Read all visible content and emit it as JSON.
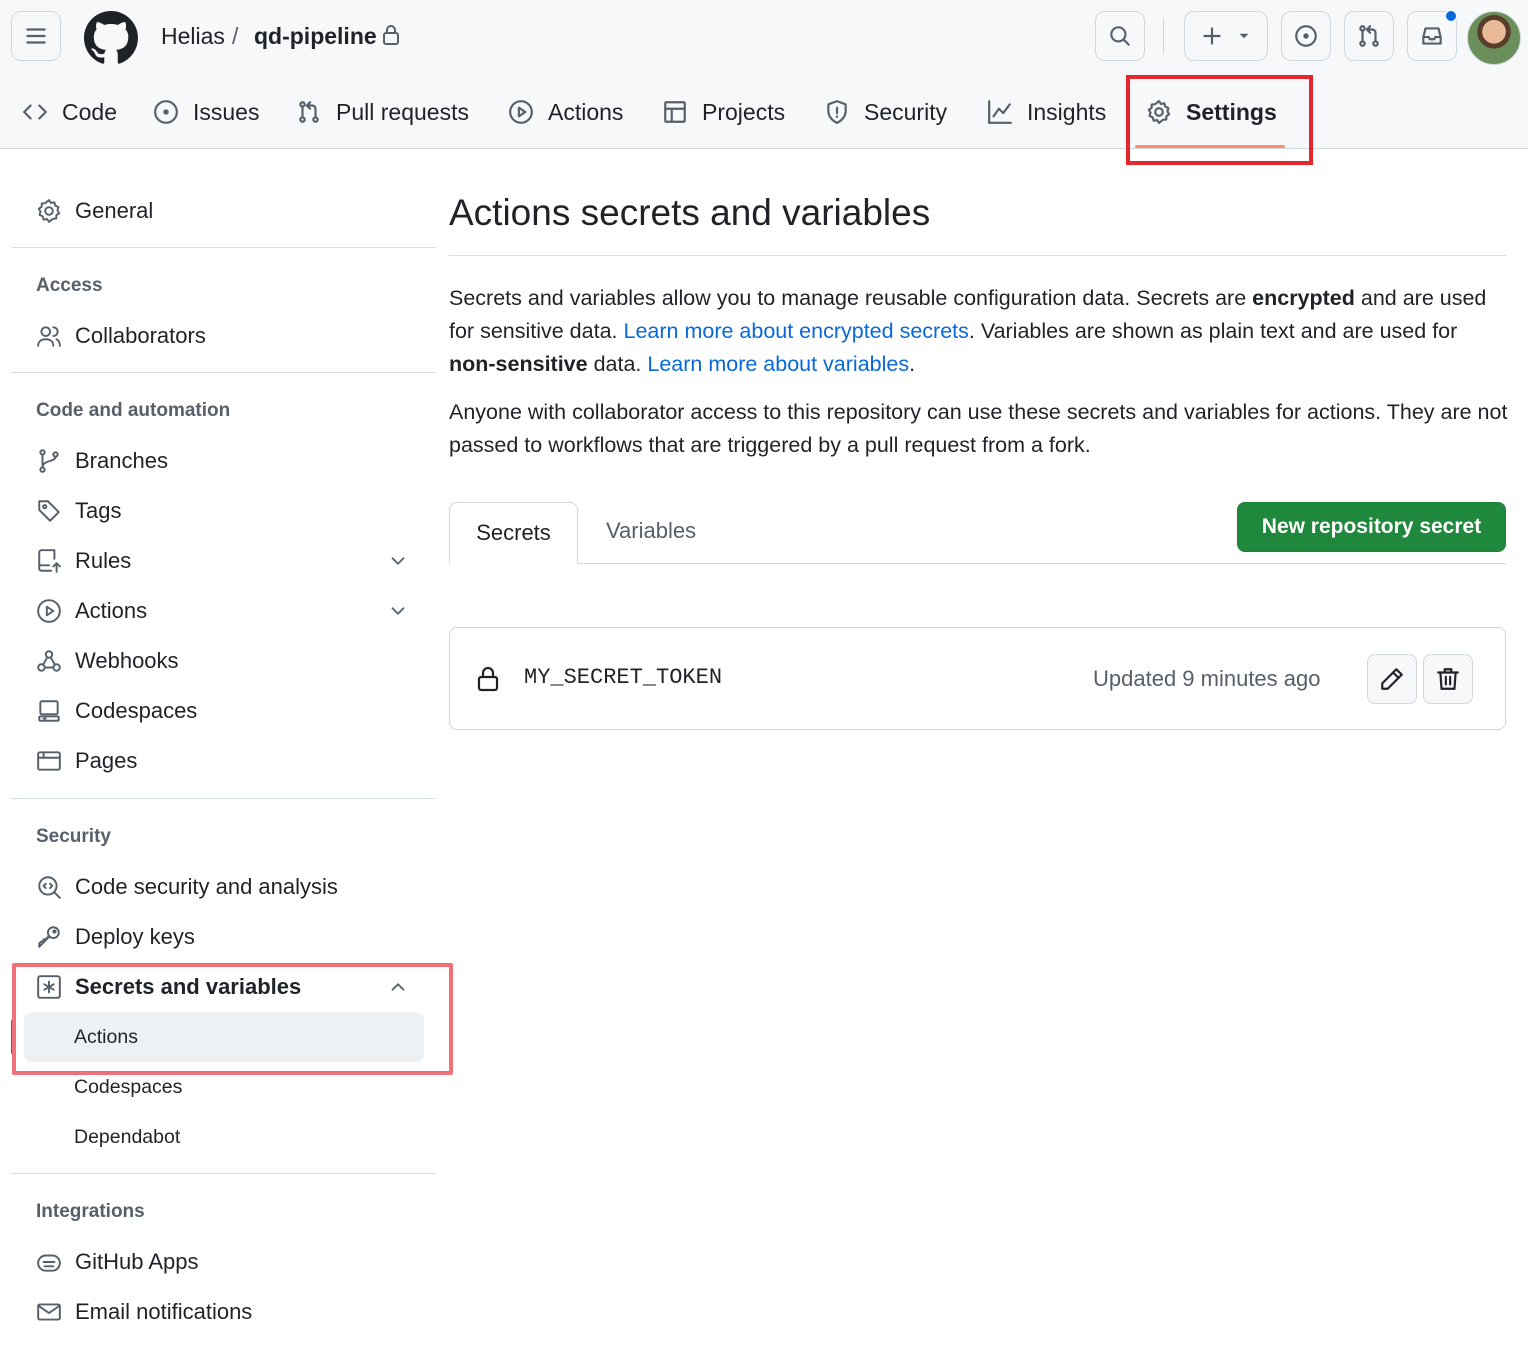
{
  "header": {
    "owner": "Helias",
    "separator": "/",
    "repo": "qd-pipeline",
    "icons": [
      "menu-icon",
      "github-logo",
      "lock-icon",
      "search-icon",
      "plus-icon",
      "triangle-down-icon",
      "issue-opened-icon",
      "git-pull-request-icon",
      "inbox-icon",
      "avatar"
    ]
  },
  "repo_nav": {
    "tabs": [
      {
        "label": "Code",
        "icon": "code-icon"
      },
      {
        "label": "Issues",
        "icon": "issue-opened-icon"
      },
      {
        "label": "Pull requests",
        "icon": "git-pull-request-icon"
      },
      {
        "label": "Actions",
        "icon": "play-icon"
      },
      {
        "label": "Projects",
        "icon": "table-icon"
      },
      {
        "label": "Security",
        "icon": "shield-icon"
      },
      {
        "label": "Insights",
        "icon": "graph-icon"
      },
      {
        "label": "Settings",
        "icon": "gear-icon",
        "active": true
      }
    ]
  },
  "sidebar": {
    "general": "General",
    "sections": {
      "access": "Access",
      "code_automation": "Code and automation",
      "security": "Security",
      "integrations": "Integrations"
    },
    "items": {
      "collaborators": "Collaborators",
      "branches": "Branches",
      "tags": "Tags",
      "rules": "Rules",
      "actions": "Actions",
      "webhooks": "Webhooks",
      "codespaces": "Codespaces",
      "pages": "Pages",
      "code_security": "Code security and analysis",
      "deploy_keys": "Deploy keys",
      "secrets_variables": "Secrets and variables",
      "github_apps": "GitHub Apps",
      "email_notifications": "Email notifications"
    },
    "secrets_sub": {
      "actions": "Actions",
      "codespaces": "Codespaces",
      "dependabot": "Dependabot"
    }
  },
  "main": {
    "title": "Actions secrets and variables",
    "p1": {
      "t1": "Secrets and variables allow you to manage reusable configuration data. Secrets are ",
      "b1": "encrypted",
      "t2": " and are used for sensitive data. ",
      "link1": "Learn more about encrypted secrets",
      "t3": ". Variables are shown as plain text and are used for ",
      "b2": "non-sensitive",
      "t4": " data. ",
      "link2": "Learn more about variables",
      "t5": "."
    },
    "p2": "Anyone with collaborator access to this repository can use these secrets and variables for actions. They are not passed to workflows that are triggered by a pull request from a fork.",
    "tabs": {
      "secrets": "Secrets",
      "variables": "Variables"
    },
    "new_secret_button": "New repository secret",
    "secrets": [
      {
        "name": "MY_SECRET_TOKEN",
        "updated": "Updated 9 minutes ago"
      }
    ]
  },
  "colors": {
    "accent_link": "#0969da",
    "primary_button": "#1f883d",
    "active_tab_underline": "#fd8c73",
    "annotation_red": "#e5272d"
  }
}
